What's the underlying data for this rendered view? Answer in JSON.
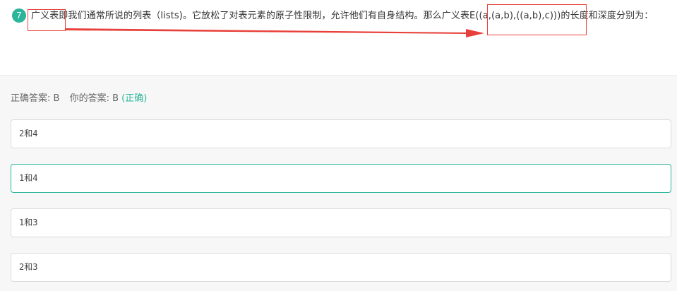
{
  "question": {
    "number": "7",
    "text": "广义表即我们通常所说的列表（lists)。它放松了对表元素的原子性限制，允许他们有自身结构。那么广义表E((a,(a,b),((a,b),c)))的长度和深度分别为："
  },
  "annotation": {
    "color": "#e8403a"
  },
  "answer": {
    "correct_label": "正确答案: B",
    "your_label": "你的答案: B",
    "status": "(正确)",
    "status_color": "#2bb59a"
  },
  "options": [
    {
      "label": "2和4",
      "selected": false
    },
    {
      "label": "1和4",
      "selected": true
    },
    {
      "label": "1和3",
      "selected": false
    },
    {
      "label": "2和3",
      "selected": false
    }
  ]
}
